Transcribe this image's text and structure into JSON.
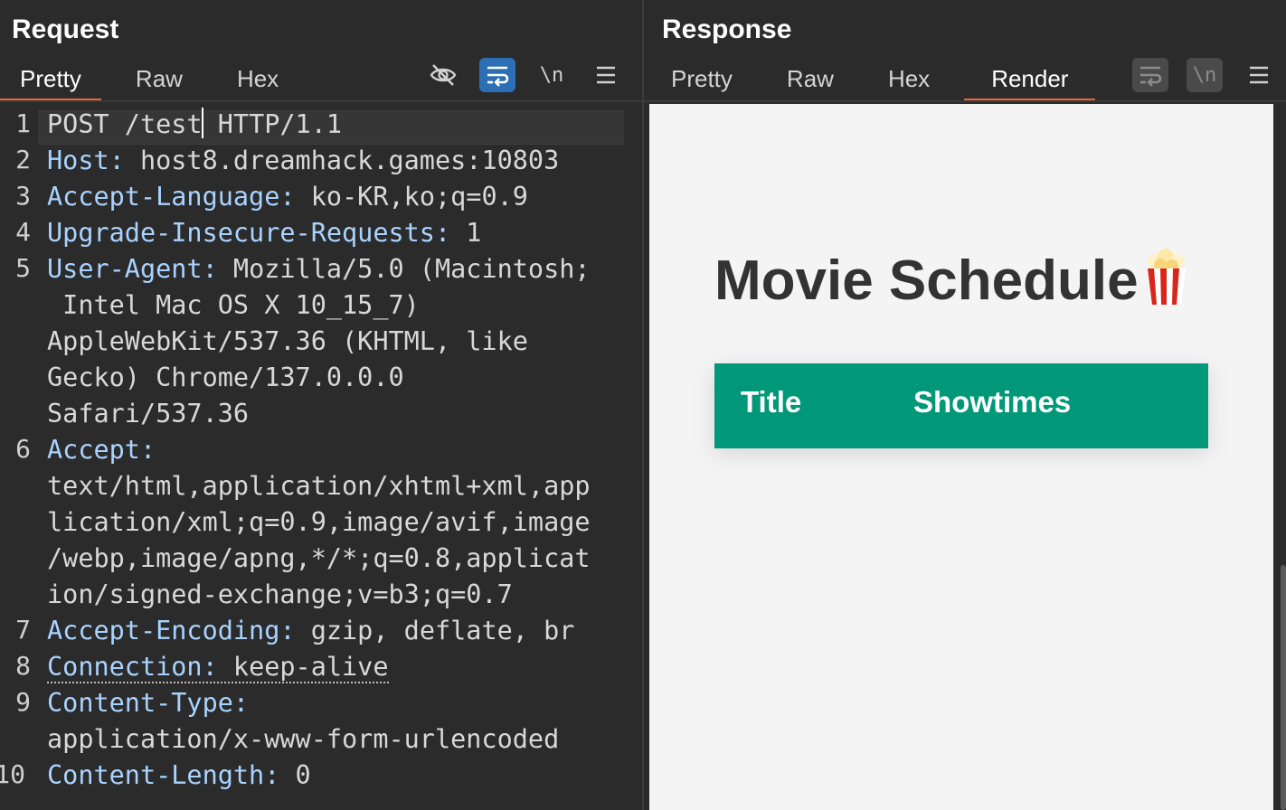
{
  "request": {
    "title": "Request",
    "tabs": [
      {
        "label": "Pretty",
        "active": true
      },
      {
        "label": "Raw",
        "active": false
      },
      {
        "label": "Hex",
        "active": false
      }
    ],
    "toolbar": {
      "hide_icon": "eye-slash-icon",
      "wrap_icon": "word-wrap-icon",
      "newline_label": "\\n",
      "menu_icon": "hamburger-menu-icon"
    },
    "lines": [
      {
        "num": "1",
        "rows": [
          [
            "POST /test",
            " HTTP/1.1"
          ]
        ]
      },
      {
        "num": "2",
        "key": "Host:",
        "rows": [
          " host8.dreamhack.games:10803"
        ]
      },
      {
        "num": "3",
        "key": "Accept-Language:",
        "rows": [
          " ko-KR,ko;q=0.9"
        ]
      },
      {
        "num": "4",
        "key": "Upgrade-Insecure-Requests:",
        "rows": [
          " 1"
        ]
      },
      {
        "num": "5",
        "key": "User-Agent:",
        "rows": [
          " Mozilla/5.0 (Macintosh;",
          " Intel Mac OS X 10_15_7)",
          "AppleWebKit/537.36 (KHTML, like",
          "Gecko) Chrome/137.0.0.0",
          "Safari/537.36"
        ]
      },
      {
        "num": "6",
        "key": "Accept:",
        "rows": [
          "",
          "text/html,application/xhtml+xml,app",
          "lication/xml;q=0.9,image/avif,image",
          "/webp,image/apng,*/*;q=0.8,applicat",
          "ion/signed-exchange;v=b3;q=0.7"
        ]
      },
      {
        "num": "7",
        "key": "Accept-Encoding:",
        "rows": [
          " gzip, deflate, br"
        ]
      },
      {
        "num": "8",
        "key": "Connection:",
        "rows": [
          " keep-alive"
        ]
      },
      {
        "num": "9",
        "key": "Content-Type:",
        "rows": [
          "",
          "application/x-www-form-urlencoded"
        ]
      },
      {
        "num": "10",
        "key": "Content-Length:",
        "rows": [
          " 0"
        ]
      }
    ]
  },
  "response": {
    "title": "Response",
    "tabs": [
      {
        "label": "Pretty",
        "active": false
      },
      {
        "label": "Raw",
        "active": false
      },
      {
        "label": "Hex",
        "active": false
      },
      {
        "label": "Render",
        "active": true
      }
    ],
    "toolbar": {
      "wrap_icon": "word-wrap-icon",
      "newline_label": "\\n",
      "menu_icon": "hamburger-menu-icon"
    },
    "render": {
      "heading": "Movie Schedule",
      "heading_icon": "popcorn-icon",
      "table_headers": [
        "Title",
        "Showtimes"
      ],
      "table_header_color": "#009879"
    }
  },
  "colors": {
    "accent_tab": "#e8663d",
    "active_button": "#2c6fb4",
    "background": "#2b2b2b"
  }
}
